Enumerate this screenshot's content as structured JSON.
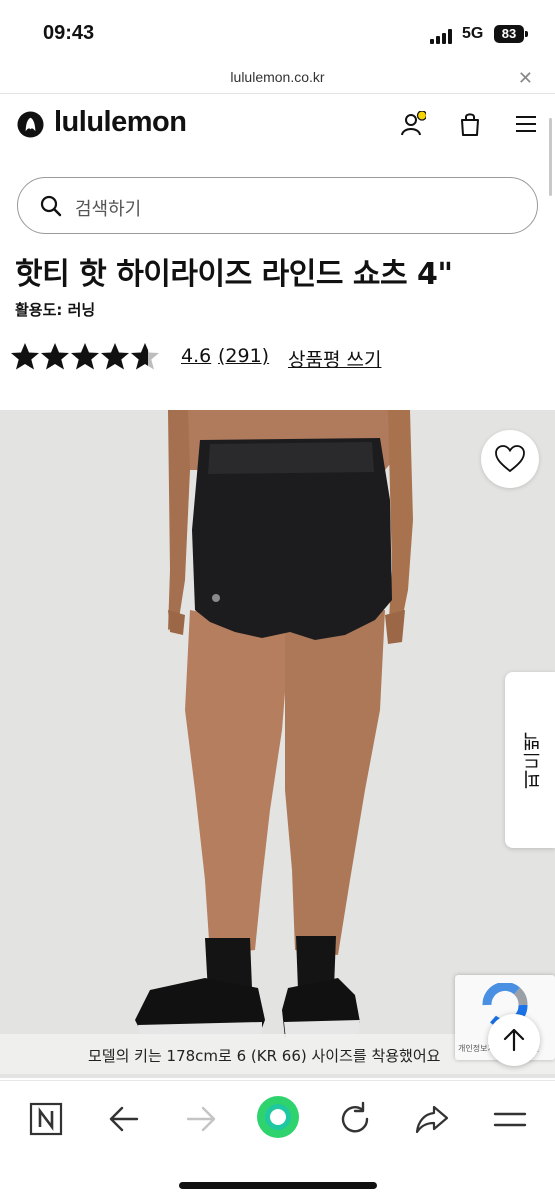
{
  "status_bar": {
    "time": "09:43",
    "network": "5G",
    "battery": "83"
  },
  "browser": {
    "url": "lululemon.co.kr",
    "close_icon": "close-icon"
  },
  "header": {
    "logo_text": "lululemon",
    "icons": [
      "account-icon",
      "shopping-bag-icon",
      "menu-icon"
    ],
    "notification_dot_color": "#f5d400"
  },
  "search": {
    "placeholder": "검색하기"
  },
  "product": {
    "title": "핫티 핫 하이라이즈 라인드 쇼츠 4\"",
    "activity": "활용도: 러닝",
    "rating": {
      "stars": 4.6,
      "value": "4.6",
      "count": "(291)",
      "write_review": "상품평 쓰기"
    },
    "image_caption": "모델의 키는 178cm로 6 (KR 66) 사이즈를 착용했어요",
    "side_tab_label": "피드백"
  },
  "captcha": {
    "text": "개인정보처리방침 - 약관"
  },
  "toolbar": {
    "buttons": [
      "naver-n-icon",
      "back-arrow-icon",
      "forward-arrow-icon",
      "green-home-icon",
      "refresh-icon",
      "share-icon",
      "menu-icon"
    ]
  },
  "colors": {
    "accent_green": "#2fd36e",
    "star": "#111111",
    "image_bg": "#e3e3e1"
  }
}
